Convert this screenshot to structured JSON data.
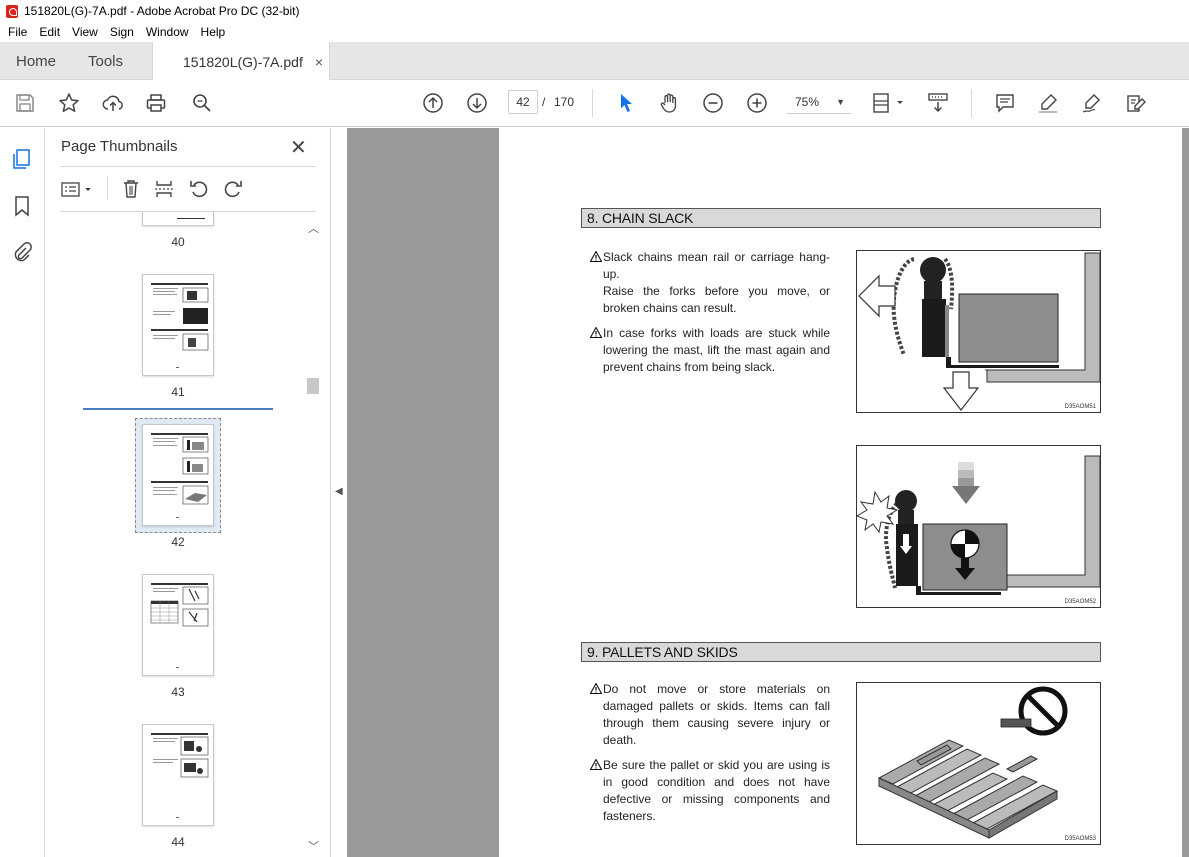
{
  "window": {
    "title": "151820L(G)-7A.pdf - Adobe Acrobat Pro DC (32-bit)"
  },
  "menu": [
    "File",
    "Edit",
    "View",
    "Sign",
    "Window",
    "Help"
  ],
  "tabs": {
    "home": "Home",
    "tools": "Tools",
    "document": "151820L(G)-7A.pdf",
    "close_glyph": "×"
  },
  "toolbar": {
    "current_page": "42",
    "page_separator": "/",
    "total_pages": "170",
    "zoom": "75%",
    "icons": [
      "save-icon",
      "star-icon",
      "upload-icon",
      "print-icon",
      "search-icon",
      "page-up-icon",
      "page-down-icon",
      "select-cursor-icon",
      "hand-icon",
      "zoom-out-icon",
      "zoom-in-icon",
      "zoom-dropdown",
      "fit-page-icon",
      "scroll-mode-icon",
      "comment-icon",
      "highlight-icon",
      "sign-icon",
      "edit-icon"
    ]
  },
  "thumbnails_panel": {
    "title": "Page Thumbnails",
    "close_glyph": "✕",
    "pages": [
      {
        "label": "40"
      },
      {
        "label": "41"
      },
      {
        "label": "42",
        "selected": true
      },
      {
        "label": "43"
      },
      {
        "label": "44"
      }
    ]
  },
  "document": {
    "sections": [
      {
        "heading": "8. CHAIN SLACK",
        "paragraphs": [
          "Slack chains mean rail or carriage hang-up.",
          "Raise the forks before you move, or broken chains can result.",
          "In case forks with loads are stuck while lowering the mast, lift the mast again and prevent chains from being slack."
        ],
        "figures": [
          "D35AOM51",
          "D35AOM52"
        ]
      },
      {
        "heading": "9. PALLETS AND SKIDS",
        "paragraphs": [
          "Do not move or store materials on damaged pallets or skids.  Items can fall through them causing severe injury or death.",
          "Be sure the pallet or skid you are using is in good condition and does not have defective or missing components and fasteners."
        ],
        "figures": [
          "D35AOM53"
        ]
      }
    ]
  },
  "colors": {
    "accent": "#4a7fbf",
    "select_cursor": "#1473e6",
    "tab_bar": "#e6e6e6",
    "doc_background": "#9a9a9a"
  }
}
